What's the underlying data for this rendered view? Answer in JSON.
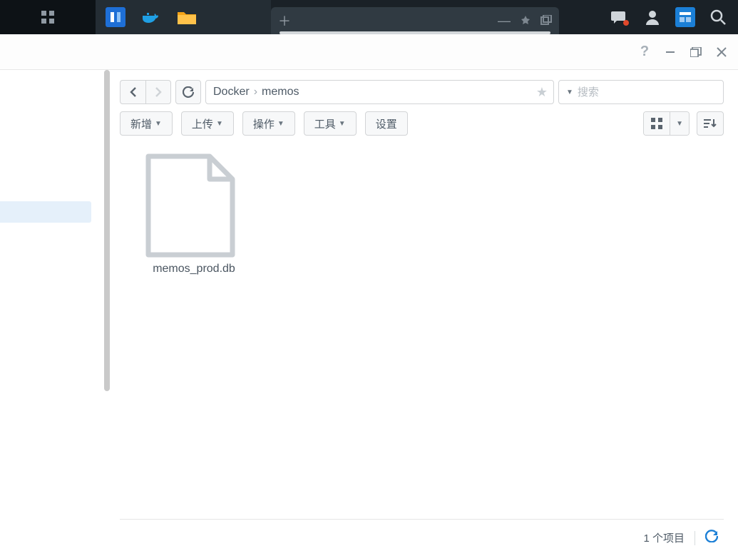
{
  "taskbar": {
    "apps": [
      "activity-monitor",
      "docker",
      "file-station"
    ],
    "tray": [
      "chat-icon",
      "user-icon",
      "widgets-icon",
      "search-icon"
    ]
  },
  "titlebar": {
    "help": "?",
    "minimize": "—",
    "maximize": "❐",
    "close": "✕"
  },
  "toolbar": {
    "breadcrumb": [
      "Docker",
      "memos"
    ],
    "search_placeholder": "搜索",
    "actions": {
      "new": "新增",
      "upload": "上传",
      "operate": "操作",
      "tools": "工具",
      "settings": "设置"
    }
  },
  "files": [
    {
      "name": "memos_prod.db",
      "type": "file"
    }
  ],
  "status": {
    "count_text": "1 个项目"
  }
}
